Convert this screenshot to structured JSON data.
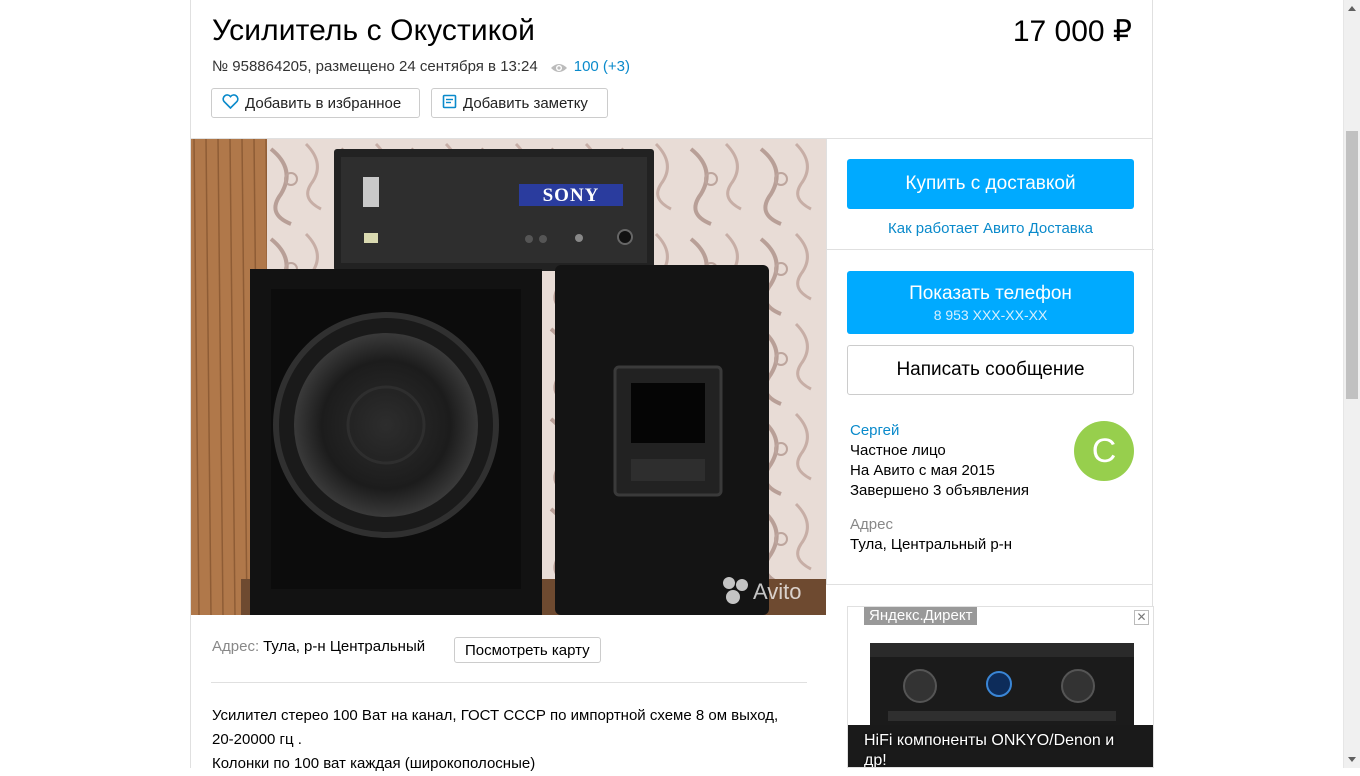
{
  "listing": {
    "title": "Усилитель с Окустикой",
    "price": "17 000 ₽",
    "number_date": "№ 958864205, размещено 24 сентября в 13:24",
    "views": "100 (+3)",
    "fav_label": "Добавить в избранное",
    "note_label": "Добавить заметку"
  },
  "photo": {
    "brand_text": "SONY",
    "watermark": "Avito"
  },
  "actions": {
    "buy_label": "Купить с доставкой",
    "delivery_link": "Как работает Авито Доставка",
    "phone_label": "Показать телефон",
    "phone_number": "8 953 XXX-XX-XX",
    "message_label": "Написать сообщение"
  },
  "seller": {
    "name": "Сергей",
    "type": "Частное лицо",
    "since": "На Авито с мая 2015",
    "completed": "Завершено 3 объявления",
    "avatar_letter": "С",
    "avatar_color": "#97cf4d",
    "address_label": "Адрес",
    "address_value": "Тула, Центральный р-н"
  },
  "ad": {
    "tag": "Яндекс.Директ",
    "text": "HiFi компоненты ONKYO/Denon и др!",
    "close": "✕"
  },
  "location": {
    "label": "Адрес:",
    "value": "Тула, р-н Центральный",
    "map_button": "Посмотреть карту"
  },
  "description": {
    "line1": "Усилител стерео 100 Ват на канал, ГОСТ СССР по импортной схеме 8 ом выход,",
    "line2": "20-20000 гц .",
    "line3": "Колонки по 100 ват каждая (широкополосные)"
  },
  "colors": {
    "accent": "#00aaff",
    "link": "#0a8acb"
  }
}
